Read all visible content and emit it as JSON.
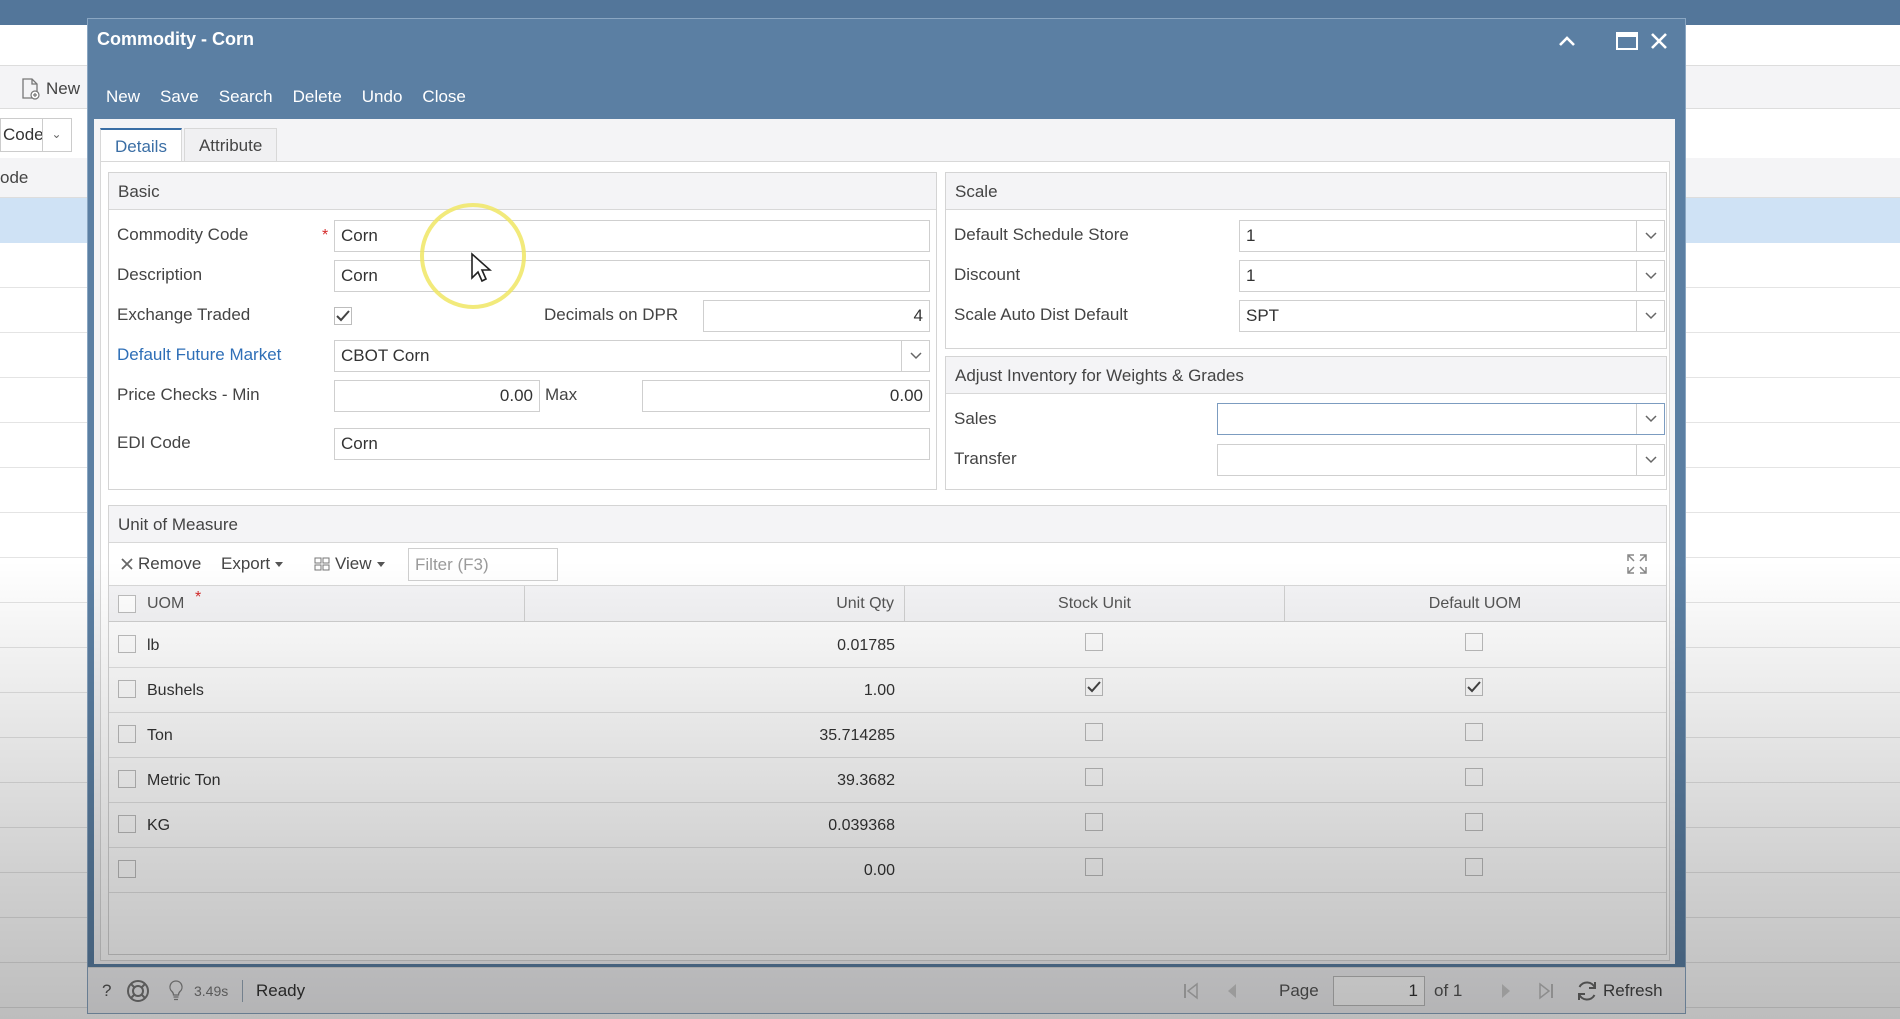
{
  "background": {
    "toolbar_new": "New",
    "filter_value": "Code",
    "column_header": "ode"
  },
  "window": {
    "title": "Commodity - Corn",
    "controls": {
      "collapse": "collapse",
      "maximize": "maximize",
      "close": "close"
    },
    "toolbar": [
      "New",
      "Save",
      "Search",
      "Delete",
      "Undo",
      "Close"
    ]
  },
  "tabs": [
    {
      "label": "Details",
      "active": true
    },
    {
      "label": "Attribute",
      "active": false
    }
  ],
  "basic": {
    "title": "Basic",
    "commodity_code_label": "Commodity Code",
    "commodity_code_value": "Corn",
    "description_label": "Description",
    "description_value": "Corn",
    "exchange_traded_label": "Exchange Traded",
    "exchange_traded_checked": true,
    "decimals_label": "Decimals on DPR",
    "decimals_value": "4",
    "future_market_label": "Default Future Market",
    "future_market_value": "CBOT Corn",
    "price_min_label": "Price Checks - Min",
    "price_min_value": "0.00",
    "price_max_label": "Max",
    "price_max_value": "0.00",
    "edi_label": "EDI Code",
    "edi_value": "Corn"
  },
  "scale": {
    "title": "Scale",
    "schedule_store_label": "Default Schedule Store",
    "schedule_store_value": "1",
    "discount_label": "Discount",
    "discount_value": "1",
    "auto_dist_label": "Scale Auto Dist Default",
    "auto_dist_value": "SPT"
  },
  "adjust": {
    "title": "Adjust Inventory for Weights & Grades",
    "sales_label": "Sales",
    "sales_value": "",
    "transfer_label": "Transfer",
    "transfer_value": ""
  },
  "uom": {
    "title": "Unit of Measure",
    "toolbar": {
      "remove": "Remove",
      "export": "Export",
      "view": "View",
      "filter_placeholder": "Filter (F3)"
    },
    "columns": {
      "uom": "UOM",
      "unit_qty": "Unit Qty",
      "stock_unit": "Stock Unit",
      "default_uom": "Default UOM"
    },
    "rows": [
      {
        "uom": "lb",
        "unit_qty": "0.01785",
        "stock_unit": false,
        "default_uom": false
      },
      {
        "uom": "Bushels",
        "unit_qty": "1.00",
        "stock_unit": true,
        "default_uom": true
      },
      {
        "uom": "Ton",
        "unit_qty": "35.714285",
        "stock_unit": false,
        "default_uom": false
      },
      {
        "uom": "Metric Ton",
        "unit_qty": "39.3682",
        "stock_unit": false,
        "default_uom": false
      },
      {
        "uom": "KG",
        "unit_qty": "0.039368",
        "stock_unit": false,
        "default_uom": false
      },
      {
        "uom": "",
        "unit_qty": "0.00",
        "stock_unit": false,
        "default_uom": false
      }
    ]
  },
  "status": {
    "timing": "3.49s",
    "state": "Ready",
    "page_label": "Page",
    "page_value": "1",
    "page_of": "of 1",
    "refresh": "Refresh"
  }
}
